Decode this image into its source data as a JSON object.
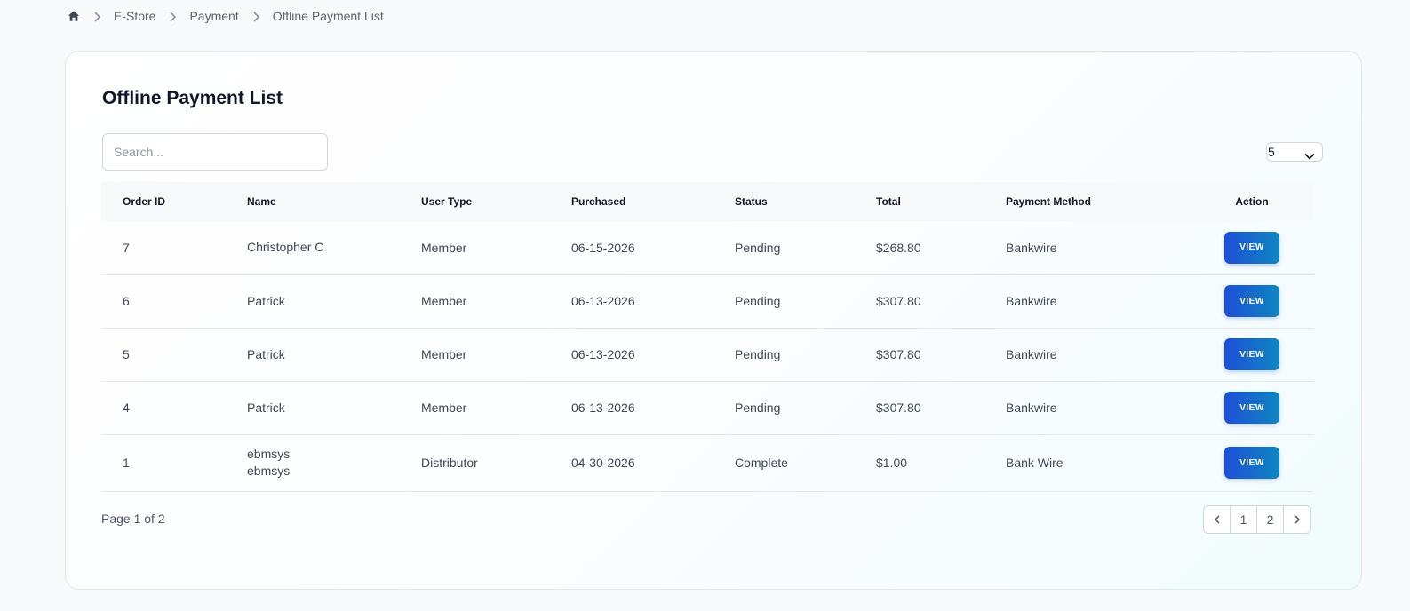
{
  "breadcrumb": {
    "items": [
      "E-Store",
      "Payment",
      "Offline Payment List"
    ]
  },
  "page": {
    "title": "Offline Payment List",
    "search_placeholder": "Search...",
    "per_page_value": "5"
  },
  "table": {
    "headers": [
      "Order ID",
      "Name",
      "User Type",
      "Purchased",
      "Status",
      "Total",
      "Payment Method",
      "Action"
    ],
    "rows": [
      {
        "order_id": "7",
        "name_line1": "Christopher C",
        "name_line2": "",
        "user_type": "Member",
        "purchased": "06-15-2026",
        "status": "Pending",
        "total": "$268.80",
        "method": "Bankwire",
        "action": "VIEW"
      },
      {
        "order_id": "6",
        "name_line1": "Patrick",
        "name_line2": "",
        "user_type": "Member",
        "purchased": "06-13-2026",
        "status": "Pending",
        "total": "$307.80",
        "method": "Bankwire",
        "action": "VIEW"
      },
      {
        "order_id": "5",
        "name_line1": "Patrick",
        "name_line2": "",
        "user_type": "Member",
        "purchased": "06-13-2026",
        "status": "Pending",
        "total": "$307.80",
        "method": "Bankwire",
        "action": "VIEW"
      },
      {
        "order_id": "4",
        "name_line1": "Patrick",
        "name_line2": "",
        "user_type": "Member",
        "purchased": "06-13-2026",
        "status": "Pending",
        "total": "$307.80",
        "method": "Bankwire",
        "action": "VIEW"
      },
      {
        "order_id": "1",
        "name_line1": "ebmsys",
        "name_line2": "ebmsys",
        "user_type": "Distributor",
        "purchased": "04-30-2026",
        "status": "Complete",
        "total": "$1.00",
        "method": "Bank Wire",
        "action": "VIEW"
      }
    ]
  },
  "pagination": {
    "info": "Page 1 of 2",
    "pages": [
      "1",
      "2"
    ]
  },
  "icons": {
    "home": "home-icon",
    "separator": "chevron-right-icon",
    "dropdown": "chevron-down-icon",
    "prev": "chevron-left-icon",
    "next": "chevron-right-icon"
  },
  "colors": {
    "button_start": "#1d4fd6",
    "button_end": "#0e86c0",
    "title": "#0f172a"
  }
}
